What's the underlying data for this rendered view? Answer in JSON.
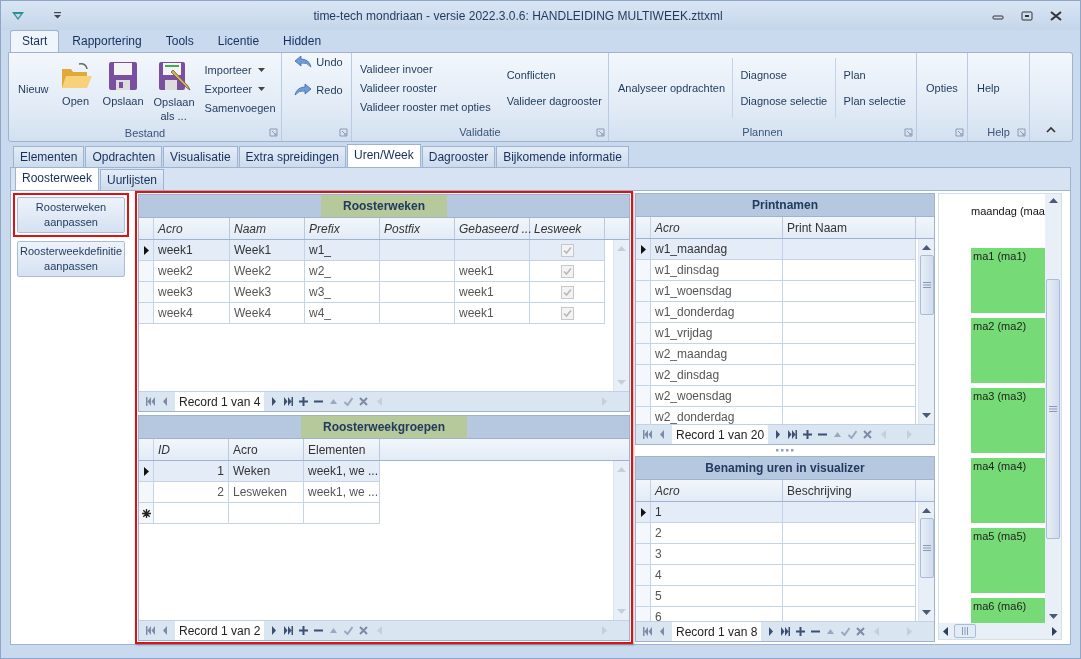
{
  "window": {
    "title": "time-tech mondriaan - versie 2022.3.0.6: HANDLEIDING MULTIWEEK.zttxml"
  },
  "ribbon_tabs": [
    {
      "label": "Start",
      "selected": true
    },
    {
      "label": "Rapportering",
      "selected": false
    },
    {
      "label": "Tools",
      "selected": false
    },
    {
      "label": "Licentie",
      "selected": false
    },
    {
      "label": "Hidden",
      "selected": false
    }
  ],
  "ribbon_groups": [
    {
      "label": "Bestand",
      "items": [
        {
          "label": "Nieuw"
        },
        {
          "label": "Open"
        },
        {
          "label": "Opslaan"
        },
        {
          "label": "Opslaan als ..."
        },
        {
          "label": "Importeer",
          "dropdown": true
        },
        {
          "label": "Exporteer",
          "dropdown": true
        },
        {
          "label": "Samenvoegen",
          "dropdown": false
        }
      ]
    },
    {
      "items": [
        {
          "label": "Undo"
        },
        {
          "label": "Redo"
        }
      ]
    },
    {
      "label": "Validatie",
      "items": [
        {
          "label": "Valideer invoer"
        },
        {
          "label": "Valideer rooster"
        },
        {
          "label": "Valideer rooster met opties"
        },
        {
          "label": "Conflicten"
        },
        {
          "label": "Valideer dagrooster"
        }
      ]
    },
    {
      "label": "Plannen",
      "items": [
        {
          "label": "Analyseer opdrachten"
        },
        {
          "label": "Diagnose"
        },
        {
          "label": "Diagnose selectie"
        },
        {
          "label": "Plan"
        },
        {
          "label": "Plan selectie"
        }
      ]
    },
    {
      "items": [
        {
          "label": "Opties"
        }
      ]
    },
    {
      "label": "Help",
      "items": [
        {
          "label": "Help"
        }
      ]
    }
  ],
  "main_tabs": [
    {
      "label": "Elementen",
      "selected": false
    },
    {
      "label": "Opdrachten",
      "selected": false
    },
    {
      "label": "Visualisatie",
      "selected": false
    },
    {
      "label": "Extra spreidingen",
      "selected": false
    },
    {
      "label": "Uren/Week",
      "selected": true
    },
    {
      "label": "Dagrooster",
      "selected": false
    },
    {
      "label": "Bijkomende informatie",
      "selected": false
    }
  ],
  "sub_tabs": [
    {
      "label": "Roosterweek",
      "selected": true
    },
    {
      "label": "Uurlijsten",
      "selected": false
    }
  ],
  "side_buttons": [
    {
      "label": "Roosterweken aanpassen",
      "highlighted": true
    },
    {
      "label": "Roosterweekdefinitie aanpassen",
      "highlighted": false
    }
  ],
  "middle_panel": {
    "highlighted": true
  },
  "grids": [
    {
      "title": "Roosterweken",
      "columns": [
        {
          "label": "Acro",
          "italic": true
        },
        {
          "label": "Naam",
          "italic": true
        },
        {
          "label": "Prefix",
          "italic": true
        },
        {
          "label": "Postfix",
          "italic": true
        },
        {
          "label": "Gebaseerd ...",
          "italic": true
        },
        {
          "label": "Lesweek",
          "italic": true
        }
      ],
      "rows": [
        {
          "cells": [
            "week1",
            "Week1",
            "w1_",
            null,
            null,
            true
          ],
          "selected": true
        },
        {
          "cells": [
            "week2",
            "Week2",
            "w2_",
            null,
            "week1",
            true
          ],
          "selected": false
        },
        {
          "cells": [
            "week3",
            "Week3",
            "w3_",
            null,
            "week1",
            true
          ],
          "selected": false
        },
        {
          "cells": [
            "week4",
            "Week4",
            "w4_",
            null,
            "week1",
            true
          ],
          "selected": false
        }
      ],
      "new_row": false,
      "record": "Record 1 van 4"
    },
    {
      "title": "Roosterweekgroepen",
      "columns": [
        {
          "label": "ID",
          "italic": true
        },
        {
          "label": "Acro",
          "italic": false
        },
        {
          "label": "Elementen",
          "italic": false
        }
      ],
      "rows": [
        {
          "cells": [
            "1",
            "Weken",
            "week1, we ..."
          ],
          "selected": true
        },
        {
          "cells": [
            "2",
            "Lesweken",
            "week1, we ..."
          ],
          "selected": false
        }
      ],
      "new_row": true,
      "record": "Record 1 van 2"
    },
    {
      "title": "Printnamen",
      "columns": [
        {
          "label": "Acro",
          "italic": true
        },
        {
          "label": "Print Naam",
          "italic": false
        }
      ],
      "rows": [
        {
          "cells": [
            "w1_maandag",
            null
          ],
          "selected": true
        },
        {
          "cells": [
            "w1_dinsdag",
            null
          ],
          "selected": false
        },
        {
          "cells": [
            "w1_woensdag",
            null
          ],
          "selected": false
        },
        {
          "cells": [
            "w1_donderdag",
            null
          ],
          "selected": false
        },
        {
          "cells": [
            "w1_vrijdag",
            null
          ],
          "selected": false
        },
        {
          "cells": [
            "w2_maandag",
            null
          ],
          "selected": false
        },
        {
          "cells": [
            "w2_dinsdag",
            null
          ],
          "selected": false
        },
        {
          "cells": [
            "w2_woensdag",
            null
          ],
          "selected": false
        },
        {
          "cells": [
            "w2_donderdag",
            null
          ],
          "selected": false
        }
      ],
      "new_row": false,
      "record": "Record 1 van 20"
    },
    {
      "title": "Benaming uren in visualizer",
      "columns": [
        {
          "label": "Acro",
          "italic": true
        },
        {
          "label": "Beschrijving",
          "italic": false
        }
      ],
      "rows": [
        {
          "cells": [
            "1",
            null
          ],
          "selected": true
        },
        {
          "cells": [
            "2",
            null
          ],
          "selected": false
        },
        {
          "cells": [
            "3",
            null
          ],
          "selected": false
        },
        {
          "cells": [
            "4",
            null
          ],
          "selected": false
        },
        {
          "cells": [
            "5",
            null
          ],
          "selected": false
        },
        {
          "cells": [
            "6",
            null
          ],
          "selected": false
        }
      ],
      "new_row": false,
      "record": "Record 1 van 8"
    }
  ],
  "visualizer": {
    "header": "maandag (maa",
    "blocks": [
      "ma1 (ma1)",
      "ma2 (ma2)",
      "ma3 (ma3)",
      "ma4 (ma4)",
      "ma5 (ma5)",
      "ma6 (ma6)"
    ]
  }
}
